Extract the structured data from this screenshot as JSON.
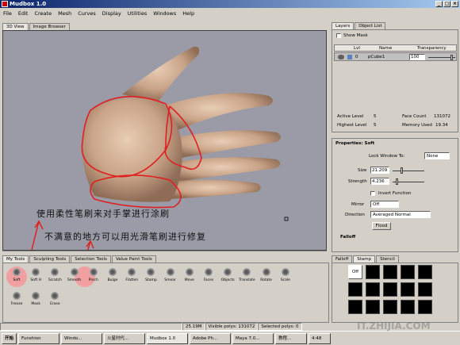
{
  "window": {
    "title": "Mudbox 1.0"
  },
  "menu": [
    "File",
    "Edit",
    "Create",
    "Mesh",
    "Curves",
    "Display",
    "Utilities",
    "Windows",
    "Help"
  ],
  "viewport_tabs": [
    "3D View",
    "Image Browser"
  ],
  "annotations": [
    "使用柔性笔刷来对手掌进行涂刷",
    "不满意的地方可以用光滑笔刷进行修复"
  ],
  "layers": {
    "tabs": [
      "Layers",
      "Object List"
    ],
    "show_mask": "Show Mask",
    "columns": [
      "Lvl",
      "Name",
      "Transparency"
    ],
    "row": {
      "level": "0",
      "name": "pCube1",
      "transparency": "100"
    },
    "active_level_label": "Active Level",
    "active_level": "5",
    "face_count_label": "Face Count",
    "face_count": "131072",
    "highest_level_label": "Highest Level",
    "highest_level": "5",
    "memory_label": "Memory Used",
    "memory": "19.34"
  },
  "properties": {
    "title": "Properties: Soft",
    "lock_label": "Lock Window To:",
    "lock_value": "None",
    "size_label": "Size",
    "size_value": "21.209",
    "strength_label": "Strength",
    "strength_value": "4.236",
    "invert_label": "Invert Function",
    "mirror_label": "Mirror",
    "mirror_value": "Off",
    "direction_label": "Direction",
    "direction_value": "Averaged Normal",
    "flood_label": "Flood",
    "falloff_label": "Falloff"
  },
  "stamp": {
    "tabs": [
      "Falloff",
      "Stamp",
      "Stencil"
    ],
    "off_label": "Off"
  },
  "tool_tabs": [
    "My Tools",
    "Sculpting Tools",
    "Selection Tools",
    "Value Paint Tools"
  ],
  "tools_row1": [
    "Soft",
    "Soft H",
    "Scratch",
    "Smooth",
    "Pinch",
    "Bulge",
    "Flatten",
    "Stamp",
    "Smear",
    "Move",
    "Faces",
    "Objects",
    "Translate",
    "Rotate",
    "Scale"
  ],
  "tools_row2": [
    "Freeze",
    "Mask",
    "Erase"
  ],
  "status": {
    "fps": "25.19M",
    "visible": "Visible polys: 131072",
    "selected": "Selected polys: 0"
  },
  "taskbar": {
    "start": "开始",
    "items": [
      "Funshion",
      "Windo...",
      "火星时代...",
      "Mudbox 1.0",
      "Adobe Ph...",
      "Maya 7.0...",
      "教程..."
    ],
    "clock": "4:48"
  },
  "watermark": "IT.ZHIJIA.COM"
}
